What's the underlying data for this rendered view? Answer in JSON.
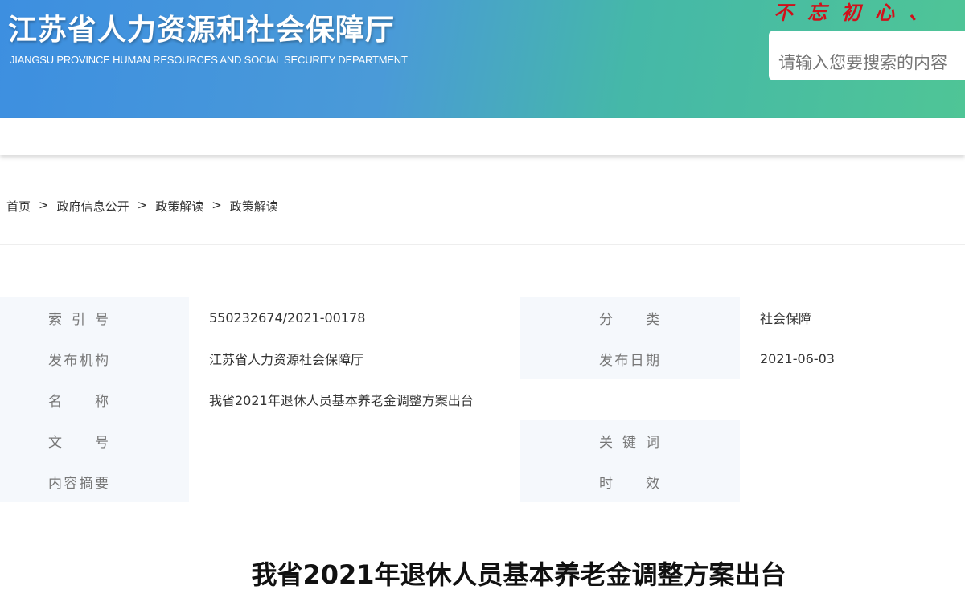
{
  "header": {
    "title": "江苏省人力资源和社会保障厅",
    "subtitle": "JIANGSU PROVINCE HUMAN RESOURCES AND SOCIAL SECURITY DEPARTMENT",
    "slogan": "不忘初心、",
    "search_placeholder": "请输入您要搜索的内容"
  },
  "breadcrumb": [
    "首页",
    "政府信息公开",
    "政策解读",
    "政策解读"
  ],
  "breadcrumb_sep": ">",
  "meta": {
    "index_label": "索引号",
    "index_value": "550232674/2021-00178",
    "category_label": "分类",
    "category_value": "社会保障",
    "agency_label": "发布机构",
    "agency_value": "江苏省人力资源社会保障厅",
    "date_label": "发布日期",
    "date_value": "2021-06-03",
    "name_label": "名称",
    "name_value": "我省2021年退休人员基本养老金调整方案出台",
    "docno_label": "文号",
    "docno_value": "",
    "keywords_label": "关键词",
    "keywords_value": "",
    "summary_label": "内容摘要",
    "summary_value": "",
    "validity_label": "时效",
    "validity_value": ""
  },
  "article": {
    "title": "我省2021年退休人员基本养老金调整方案出台"
  }
}
